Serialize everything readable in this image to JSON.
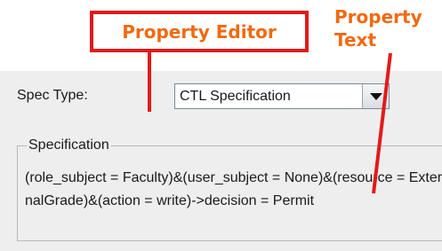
{
  "annotations": {
    "box_label": "Property Editor",
    "text_label_line1": "Property",
    "text_label_line2": "Text",
    "color": "#e21a1a",
    "text_color": "#f06a10"
  },
  "form": {
    "spec_type_label": "Spec Type:",
    "spec_type_value": "CTL Specification",
    "specification_title": "Specification",
    "specification_text": "(role_subject = Faculty)&(user_subject = None)&(resource = ExternalGrade)&(action = write)->decision = Permit"
  },
  "icons": {
    "dropdown": "chevron-down-icon"
  }
}
